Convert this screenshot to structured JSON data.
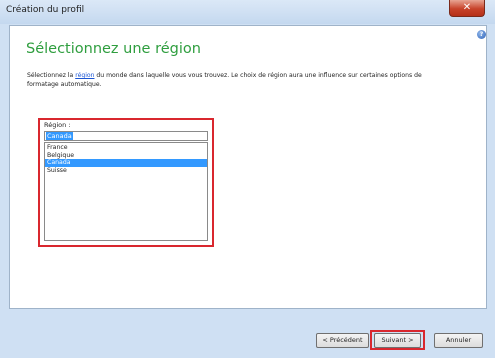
{
  "window": {
    "title": "Création du profil"
  },
  "icons": {
    "close": "close-icon",
    "help": "help-icon"
  },
  "heading": "Sélectionnez une région",
  "description": {
    "before_link": "Sélectionnez la ",
    "link": "région",
    "after_link": " du monde dans laquelle vous vous trouvez. Le choix de région aura une influence sur certaines options de formatage automatique."
  },
  "region": {
    "label": "Région :",
    "value": "Canada",
    "options": [
      {
        "label": "France",
        "selected": false
      },
      {
        "label": "Belgique",
        "selected": false
      },
      {
        "label": "Canada",
        "selected": true
      },
      {
        "label": "Suisse",
        "selected": false
      }
    ]
  },
  "buttons": {
    "previous": "< Précédent",
    "next": "Suivant >",
    "cancel": "Annuler"
  },
  "colors": {
    "heading": "#2f9e3f",
    "highlight": "#d9272e",
    "selection": "#3399ff",
    "link": "#1a55d4"
  }
}
